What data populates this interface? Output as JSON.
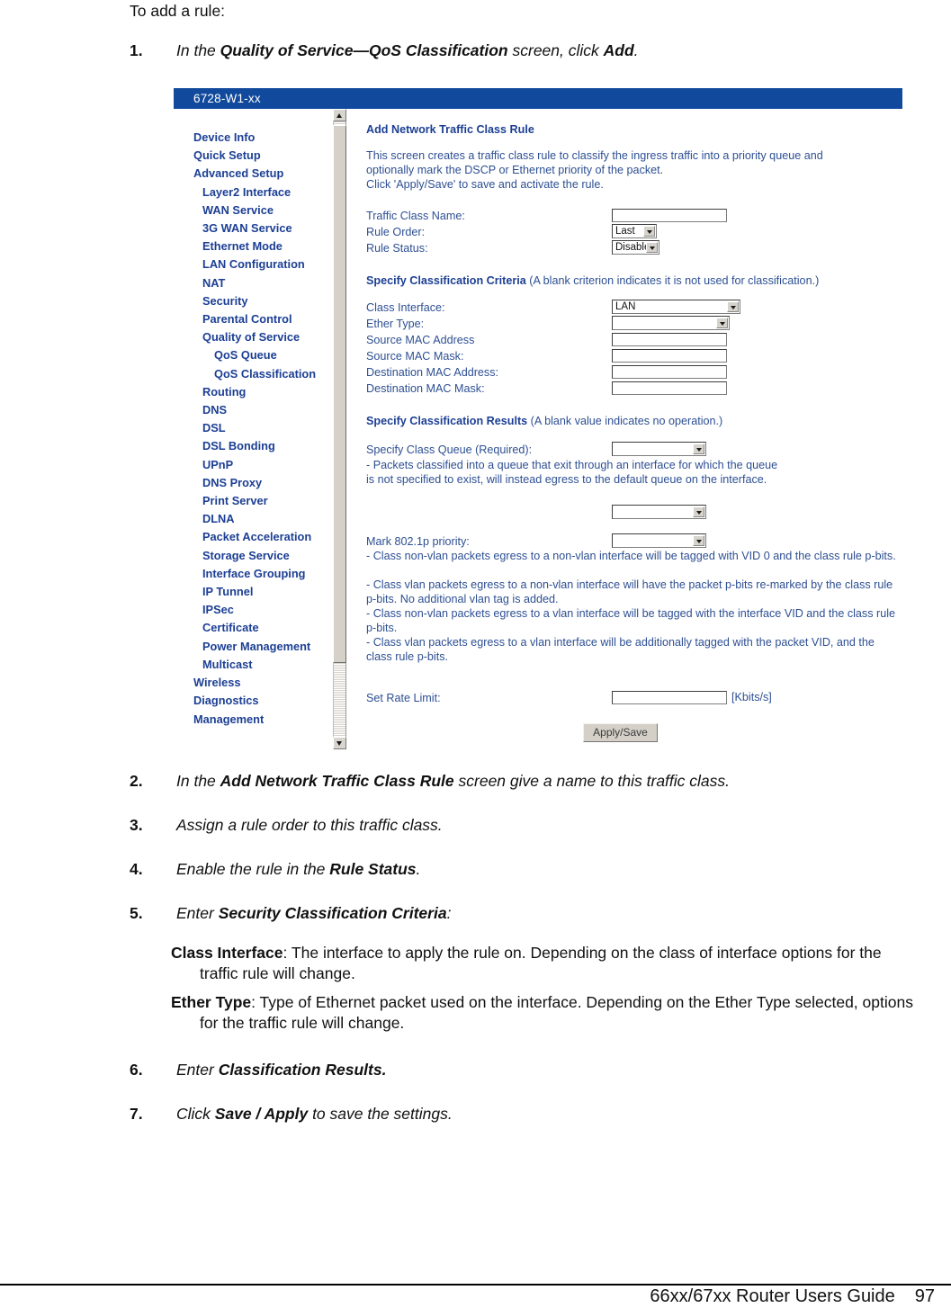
{
  "document": {
    "intro": "To add a rule:",
    "steps": [
      {
        "num": "1.",
        "html": "In the <b>Quality of Service—QoS Classification</b> screen, click <b>Add</b>."
      },
      {
        "num": "2.",
        "html": "In the <b>Add Network Traffic Class Rule</b> screen give a name to this traffic class."
      },
      {
        "num": "3.",
        "html": "Assign a rule order to this traffic class."
      },
      {
        "num": "4.",
        "html": "Enable the rule in the <b>Rule Status</b>."
      },
      {
        "num": "5.",
        "html": "Enter <b>Security Classification Criteria</b>:"
      },
      {
        "num": "6.",
        "html": "Enter <b>Classification Results.</b>"
      },
      {
        "num": "7.",
        "html": "Click <b>Save / Apply</b> to save the settings."
      }
    ],
    "definitions": [
      {
        "term": "Class Interface",
        "text": ": The interface to apply the rule on. Depending on the class of interface options for the traffic rule will change."
      },
      {
        "term": "Ether Type",
        "text": ": Type of Ethernet packet used on the interface. Depending on the Ether Type selected, options for the traffic rule will change."
      }
    ],
    "footer": {
      "title": "66xx/67xx Router Users Guide",
      "page": "97"
    }
  },
  "screenshot": {
    "titlebar": "6728-W1-xx",
    "colors": {
      "titlebar_bg": "#114a9c",
      "nav_text": "#1c3f94",
      "body_text": "#2d4f93",
      "button_face": "#d4d0c8"
    },
    "sidebar": [
      {
        "label": "Device Info",
        "level": 0
      },
      {
        "label": "Quick Setup",
        "level": 0
      },
      {
        "label": "Advanced Setup",
        "level": 0
      },
      {
        "label": "Layer2 Interface",
        "level": 1
      },
      {
        "label": "WAN Service",
        "level": 1
      },
      {
        "label": "3G WAN Service",
        "level": 1
      },
      {
        "label": "Ethernet Mode",
        "level": 1
      },
      {
        "label": "LAN Configuration",
        "level": 1
      },
      {
        "label": "NAT",
        "level": 1
      },
      {
        "label": "Security",
        "level": 1
      },
      {
        "label": "Parental Control",
        "level": 1
      },
      {
        "label": "Quality of Service",
        "level": 1
      },
      {
        "label": "QoS Queue",
        "level": 2
      },
      {
        "label": "QoS Classification",
        "level": 2
      },
      {
        "label": "Routing",
        "level": 1
      },
      {
        "label": "DNS",
        "level": 1
      },
      {
        "label": "DSL",
        "level": 1
      },
      {
        "label": "DSL Bonding",
        "level": 1
      },
      {
        "label": "UPnP",
        "level": 1
      },
      {
        "label": "DNS Proxy",
        "level": 1
      },
      {
        "label": "Print Server",
        "level": 1
      },
      {
        "label": "DLNA",
        "level": 1
      },
      {
        "label": "Packet Acceleration",
        "level": 1
      },
      {
        "label": "Storage Service",
        "level": 1
      },
      {
        "label": "Interface Grouping",
        "level": 1
      },
      {
        "label": "IP Tunnel",
        "level": 1
      },
      {
        "label": "IPSec",
        "level": 1
      },
      {
        "label": "Certificate",
        "level": 1
      },
      {
        "label": "Power Management",
        "level": 1
      },
      {
        "label": "Multicast",
        "level": 1
      },
      {
        "label": "Wireless",
        "level": 0
      },
      {
        "label": "Diagnostics",
        "level": 0
      },
      {
        "label": "Management",
        "level": 0
      }
    ],
    "content": {
      "page_title": "Add Network Traffic Class Rule",
      "intro_line1": "This screen creates a traffic class rule to classify the ingress traffic into a priority queue and",
      "intro_line2": "optionally mark the DSCP or Ethernet priority of the packet.",
      "intro_line3": "Click 'Apply/Save' to save and activate the rule.",
      "traffic_class_name_label": "Traffic Class Name:",
      "traffic_class_name_value": "",
      "rule_order_label": "Rule Order:",
      "rule_order_value": "Last",
      "rule_status_label": "Rule Status:",
      "rule_status_value": "Disable",
      "criteria_heading_bold": "Specify Classification Criteria",
      "criteria_heading_note": " (A blank criterion indicates it is not used for classification.)",
      "class_interface_label": "Class Interface:",
      "class_interface_value": "LAN",
      "ether_type_label": "Ether Type:",
      "ether_type_value": "",
      "source_mac_address_label": "Source MAC Address",
      "source_mac_address_value": "",
      "source_mac_mask_label": "Source MAC Mask:",
      "source_mac_mask_value": "",
      "dest_mac_address_label": "Destination MAC Address:",
      "dest_mac_address_value": "",
      "dest_mac_mask_label": "Destination MAC Mask:",
      "dest_mac_mask_value": "",
      "results_heading_bold": "Specify Classification Results",
      "results_heading_note": " (A blank value indicates no operation.)",
      "class_queue_label": "Specify Class Queue (Required):",
      "class_queue_value": "",
      "class_queue_note1": "- Packets classified into a queue that exit through an interface for which the queue",
      "class_queue_note2": "is not specified to exist, will instead egress to the default queue on the interface.",
      "dscp_mark_value": "",
      "mark_8021p_label": "Mark 802.1p priority:",
      "mark_8021p_value": "",
      "p_bits_notes": [
        "- Class non-vlan packets egress to a non-vlan interface will be tagged with VID 0 and the class rule p-bits.",
        "- Class vlan packets egress to a non-vlan interface will have the packet p-bits re-marked by the class rule p-bits. No additional vlan tag is added.",
        "- Class non-vlan packets egress to a vlan interface will be tagged with the interface VID and the class rule p-bits.",
        "- Class vlan packets egress to a vlan interface will be additionally tagged with the packet VID, and the class rule p-bits."
      ],
      "rate_limit_label": "Set Rate Limit:",
      "rate_limit_value": "",
      "rate_limit_unit": "[Kbits/s]",
      "apply_save_label": "Apply/Save"
    }
  }
}
